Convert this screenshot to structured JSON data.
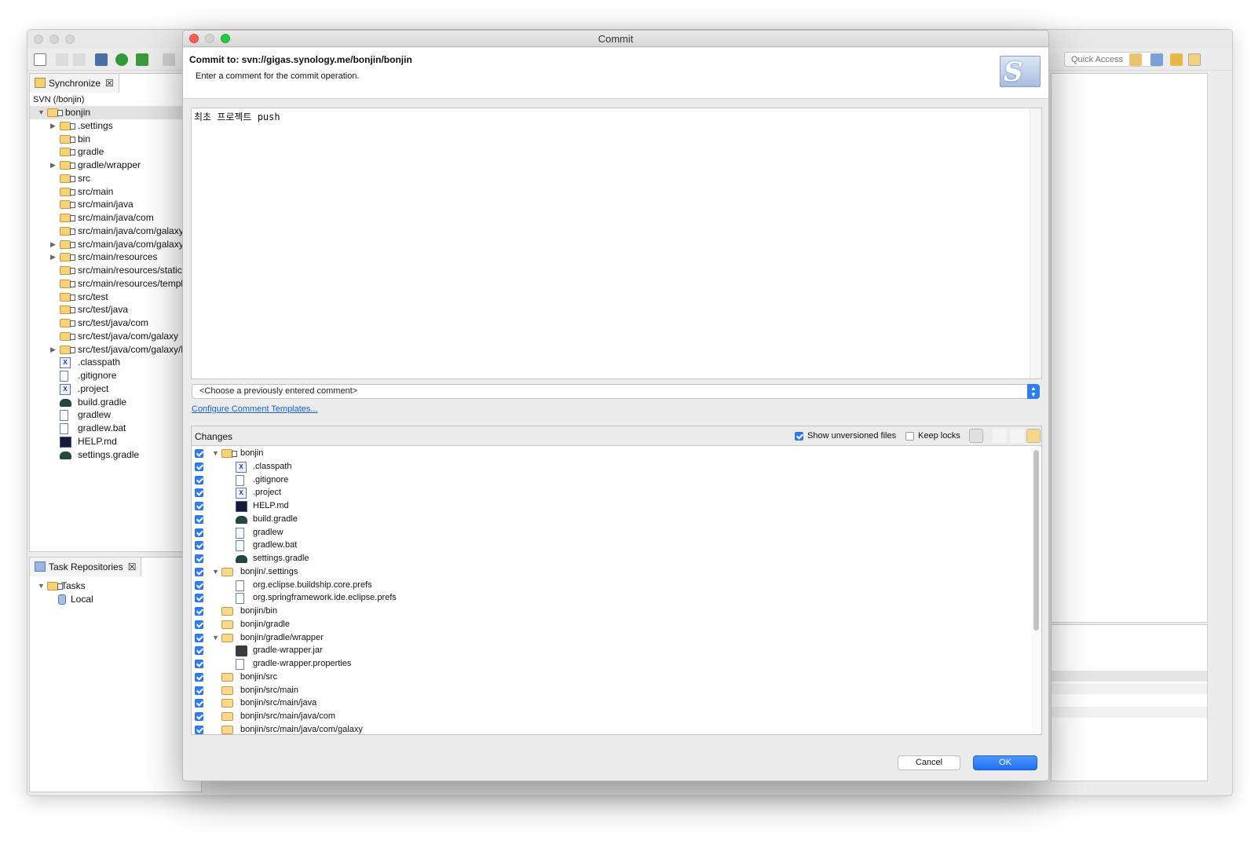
{
  "ide": {
    "quick_access_placeholder": "Quick Access",
    "sync_tab_label": "Synchronize",
    "sync_tab_close": "☒",
    "svn_root_label": "SVN (/bonjin)",
    "sync_tree": [
      {
        "label": "bonjin",
        "level": 0,
        "expander": "▼",
        "kind": "project"
      },
      {
        "label": ".settings",
        "level": 1,
        "expander": "▶",
        "kind": "folder"
      },
      {
        "label": "bin",
        "level": 1,
        "expander": "",
        "kind": "folder"
      },
      {
        "label": "gradle",
        "level": 1,
        "expander": "",
        "kind": "folder"
      },
      {
        "label": "gradle/wrapper",
        "level": 1,
        "expander": "▶",
        "kind": "folder"
      },
      {
        "label": "src",
        "level": 1,
        "expander": "",
        "kind": "folder"
      },
      {
        "label": "src/main",
        "level": 1,
        "expander": "",
        "kind": "folder"
      },
      {
        "label": "src/main/java",
        "level": 1,
        "expander": "",
        "kind": "folder"
      },
      {
        "label": "src/main/java/com",
        "level": 1,
        "expander": "",
        "kind": "folder"
      },
      {
        "label": "src/main/java/com/galaxy",
        "level": 1,
        "expander": "",
        "kind": "folder"
      },
      {
        "label": "src/main/java/com/galaxy/b",
        "level": 1,
        "expander": "▶",
        "kind": "folder"
      },
      {
        "label": "src/main/resources",
        "level": 1,
        "expander": "▶",
        "kind": "folder"
      },
      {
        "label": "src/main/resources/static",
        "level": 1,
        "expander": "",
        "kind": "folder"
      },
      {
        "label": "src/main/resources/templa",
        "level": 1,
        "expander": "",
        "kind": "folder"
      },
      {
        "label": "src/test",
        "level": 1,
        "expander": "",
        "kind": "folder"
      },
      {
        "label": "src/test/java",
        "level": 1,
        "expander": "",
        "kind": "folder"
      },
      {
        "label": "src/test/java/com",
        "level": 1,
        "expander": "",
        "kind": "folder"
      },
      {
        "label": "src/test/java/com/galaxy",
        "level": 1,
        "expander": "",
        "kind": "folder"
      },
      {
        "label": "src/test/java/com/galaxy/bo",
        "level": 1,
        "expander": "▶",
        "kind": "folder"
      },
      {
        "label": ".classpath",
        "level": 1,
        "expander": "",
        "kind": "xml"
      },
      {
        "label": ".gitignore",
        "level": 1,
        "expander": "",
        "kind": "file"
      },
      {
        "label": ".project",
        "level": 1,
        "expander": "",
        "kind": "xml"
      },
      {
        "label": "build.gradle",
        "level": 1,
        "expander": "",
        "kind": "gradle"
      },
      {
        "label": "gradlew",
        "level": 1,
        "expander": "",
        "kind": "file"
      },
      {
        "label": "gradlew.bat",
        "level": 1,
        "expander": "",
        "kind": "file"
      },
      {
        "label": "HELP.md",
        "level": 1,
        "expander": "",
        "kind": "md"
      },
      {
        "label": "settings.gradle",
        "level": 1,
        "expander": "",
        "kind": "gradle"
      }
    ],
    "task_tab_label": "Task Repositories",
    "task_tab_close": "☒",
    "task_tree": [
      {
        "label": "Tasks",
        "expander": "▼"
      },
      {
        "label": "Local",
        "expander": ""
      }
    ]
  },
  "dialog": {
    "title": "Commit",
    "header_title": "Commit to: svn://gigas.synology.me/bonjin/bonjin",
    "header_subtitle": "Enter a comment for the commit operation.",
    "logo_glyph": "S",
    "comment_text": "최초 프로젝트 push",
    "previous_comment_placeholder": "<Choose a previously entered comment>",
    "configure_link": "Configure Comment Templates...",
    "changes_title": "Changes",
    "show_unversioned_label": "Show unversioned files",
    "show_unversioned_checked": true,
    "keep_locks_label": "Keep locks",
    "keep_locks_checked": false,
    "changes": [
      {
        "label": "bonjin",
        "level": 0,
        "expander": "▼",
        "kind": "project",
        "checked": true
      },
      {
        "label": ".classpath",
        "level": 1,
        "expander": "",
        "kind": "xml",
        "checked": true
      },
      {
        "label": ".gitignore",
        "level": 1,
        "expander": "",
        "kind": "file",
        "checked": true
      },
      {
        "label": ".project",
        "level": 1,
        "expander": "",
        "kind": "xml",
        "checked": true
      },
      {
        "label": "HELP.md",
        "level": 1,
        "expander": "",
        "kind": "md",
        "checked": true
      },
      {
        "label": "build.gradle",
        "level": 1,
        "expander": "",
        "kind": "gradle",
        "checked": true
      },
      {
        "label": "gradlew",
        "level": 1,
        "expander": "",
        "kind": "file",
        "checked": true
      },
      {
        "label": "gradlew.bat",
        "level": 1,
        "expander": "",
        "kind": "file",
        "checked": true
      },
      {
        "label": "settings.gradle",
        "level": 1,
        "expander": "",
        "kind": "gradle",
        "checked": true
      },
      {
        "label": "bonjin/.settings",
        "level": 0,
        "expander": "▼",
        "kind": "folder",
        "checked": true
      },
      {
        "label": "org.eclipse.buildship.core.prefs",
        "level": 1,
        "expander": "",
        "kind": "file",
        "checked": true
      },
      {
        "label": "org.springframework.ide.eclipse.prefs",
        "level": 1,
        "expander": "",
        "kind": "file",
        "checked": true
      },
      {
        "label": "bonjin/bin",
        "level": 0,
        "expander": "",
        "kind": "folder",
        "checked": true
      },
      {
        "label": "bonjin/gradle",
        "level": 0,
        "expander": "",
        "kind": "folder",
        "checked": true
      },
      {
        "label": "bonjin/gradle/wrapper",
        "level": 0,
        "expander": "▼",
        "kind": "folder",
        "checked": true
      },
      {
        "label": "gradle-wrapper.jar",
        "level": 1,
        "expander": "",
        "kind": "jar",
        "checked": true
      },
      {
        "label": "gradle-wrapper.properties",
        "level": 1,
        "expander": "",
        "kind": "file",
        "checked": true
      },
      {
        "label": "bonjin/src",
        "level": 0,
        "expander": "",
        "kind": "folder",
        "checked": true
      },
      {
        "label": "bonjin/src/main",
        "level": 0,
        "expander": "",
        "kind": "folder",
        "checked": true
      },
      {
        "label": "bonjin/src/main/java",
        "level": 0,
        "expander": "",
        "kind": "folder",
        "checked": true
      },
      {
        "label": "bonjin/src/main/java/com",
        "level": 0,
        "expander": "",
        "kind": "folder",
        "checked": true
      },
      {
        "label": "bonjin/src/main/java/com/galaxy",
        "level": 0,
        "expander": "",
        "kind": "folder",
        "checked": true
      }
    ],
    "cancel_label": "Cancel",
    "ok_label": "OK"
  },
  "colors": {
    "accent_blue": "#2f7cf6",
    "link_blue": "#1a5fd0",
    "close_red": "#fc5f57",
    "minimize_yellow": "#fdbc2e",
    "zoom_green": "#28c840"
  }
}
